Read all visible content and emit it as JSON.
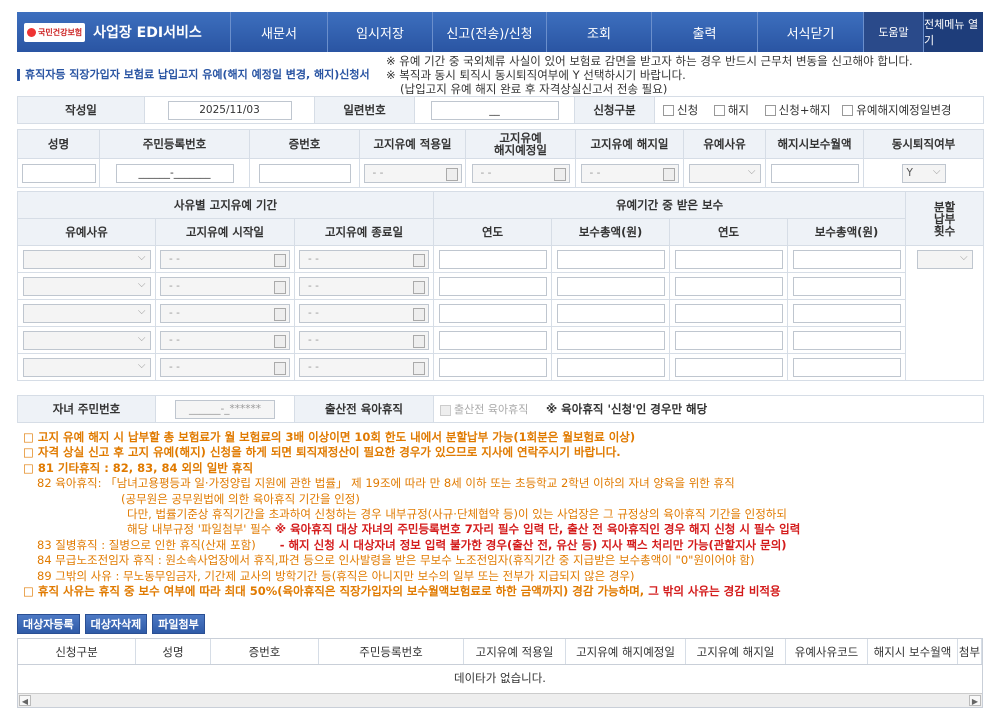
{
  "header": {
    "logo_text": "국민건강보험",
    "app_title": "사업장 EDI서비스",
    "nav": [
      "새문서",
      "임시저장",
      "신고(전송)/신청",
      "조회",
      "출력",
      "서식닫기"
    ],
    "help": "도움말",
    "all_menu": "전체메뉴 열기"
  },
  "page": {
    "subtitle": "휴직자등 직장가입자 보험료 납입고지 유예(해지 예정일 변경, 해지)신청서",
    "notices": [
      "※ 유예 기간 중 국외체류 사실이 있어 보험료 감면을 받고자 하는 경우 반드시 근무처 변동을 신고해야 합니다.",
      "※ 복직과 동시 퇴직시 동시퇴직여부에 Y 선택하시기 바랍니다.",
      "(납입고지 유예 해지 완료 후 자격상실신고서 전송 필요)"
    ]
  },
  "form": {
    "written_date_label": "작성일",
    "written_date": "2025/11/03",
    "serial_label": "일련번호",
    "serial_value": "__",
    "type_label": "신청구분",
    "type_options": [
      "신청",
      "해지",
      "신청+해지",
      "유예해지예정일변경"
    ]
  },
  "person": {
    "headers": [
      "성명",
      "주민등록번호",
      "증번호",
      "고지유예 적용일",
      "고지유예\n해지예정일",
      "고지유예 해지일",
      "유예사유",
      "해지시보수월액",
      "동시퇴직여부"
    ],
    "rrn_mask": "______-_______",
    "date_mask": "- -",
    "sim_retire": "Y"
  },
  "period": {
    "group1": "사유별 고지유예 기간",
    "group2": "유예기간 중 받은 보수",
    "split_label": "분할\n납부\n횟수",
    "cols": [
      "유예사유",
      "고지유예 시작일",
      "고지유예 종료일",
      "연도",
      "보수총액(원)",
      "연도",
      "보수총액(원)"
    ]
  },
  "child": {
    "rrn_label": "자녀 주민번호",
    "rrn_mask": "______-_******",
    "prenatal_label": "출산전 육아휴직",
    "prenatal_check": "출산전 육아휴직",
    "note": "※ 육아휴직 '신청'인 경우만 해당"
  },
  "notes": {
    "n1": "□ 고지 유예 해지 시 납부할 총 보험료가 월 보험료의 3배 이상이면 10회 한도 내에서 분할납부 가능(1회분은 월보험료 이상)",
    "n2": "□ 자격 상실 신고 후 고지 유예(해지) 신청을 하게 되면 퇴직재정산이 필요한 경우가 있으므로 지사에 연락주시기 바랍니다.",
    "n3": "□ 81 기타휴직 : 82, 83, 84 외의 일반 휴직",
    "n4a": "82 육아휴직: 「남녀고용평등과 일·가정양립 지원에 관한 법률」 제 19조에 따라 만 8세 이하 또는 초등학교 2학년 이하의 자녀 양육을 위한 휴직",
    "n4b": "(공무원은 공무원법에 의한 육아휴직 기간을 인정)",
    "n4c": "다만, 법률기준상 휴직기간을 초과하여 신청하는 경우 내부규정(사규·단체협약 등)이 있는 사업장은 그 규정상의 육아휴직 기간을 인정하되",
    "n4d": "해당 내부규정 '파일첨부' 필수",
    "n4e": "※ 육아휴직 대상 자녀의 주민등록번호 7자리 필수 입력 단, 출산 전 육아휴직인 경우 해지 신청 시 필수 입력",
    "n5a": "83 질병휴직 : 질병으로 인한 휴직(산재 포함)",
    "n5b": "- 해지 신청 시 대상자녀 정보 입력 불가한 경우(출산 전, 유산 등) 지사 팩스 처리만 가능(관할지사 문의)",
    "n6": "84 무급노조전임자 휴직 : 원소속사업장에서 휴직,파견 등으로 인사발령을 받은 무보수 노조전임자(휴직기간 중 지급받은 보수총액이 \"0\"원이어야 함)",
    "n7": "89 그밖의 사유 : 무노동무임금자, 기간제 교사의 방학기간 등(휴직은 아니지만 보수의 일부 또는 전부가 지급되지 않은 경우)",
    "n8a": "□ 휴직 사유는 휴직 중 보수 여부에 따라 최대 50%(육아휴직은 직장가입자의 보수월액보험료로 하한 금액까지) 경감 가능하며,",
    "n8b": "그 밖의 사유는 경감 비적용"
  },
  "buttons": [
    "대상자등록",
    "대상자삭제",
    "파일첨부"
  ],
  "grid": {
    "cols": [
      "신청구분",
      "성명",
      "증번호",
      "주민등록번호",
      "고지유예 적용일",
      "고지유예 해지예정일",
      "고지유예 해지일",
      "유예사유코드",
      "해지시 보수월액",
      "첨부"
    ],
    "empty": "데이타가 없습니다."
  }
}
